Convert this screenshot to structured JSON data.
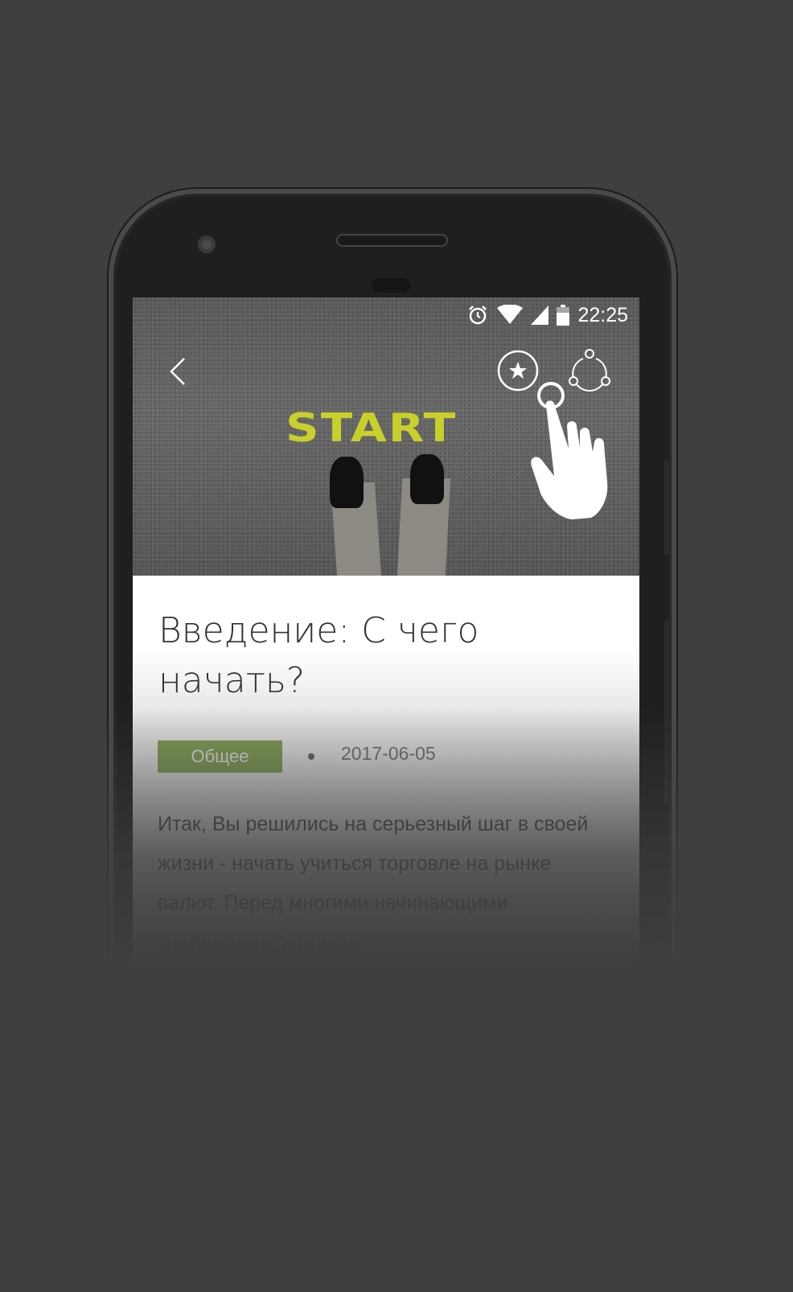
{
  "status_bar": {
    "time": "22:25"
  },
  "header": {
    "back_icon": "chevron-left-icon",
    "favorite_icon": "star-circle-icon",
    "share_icon": "share-icon"
  },
  "hero": {
    "image_text": "START"
  },
  "article": {
    "title": "Введение: С чего начать?",
    "tag": "Общее",
    "date": "2017-06-05",
    "body": "Итак, Вы решились на серьезный шаг в своей жизни - начать учиться торговле на рынке валют. Перед многими начинающими трейдерами, которые"
  },
  "colors": {
    "background": "#3f3f3f",
    "tag": "#8aad55",
    "start_text": "#c9cf2b"
  }
}
